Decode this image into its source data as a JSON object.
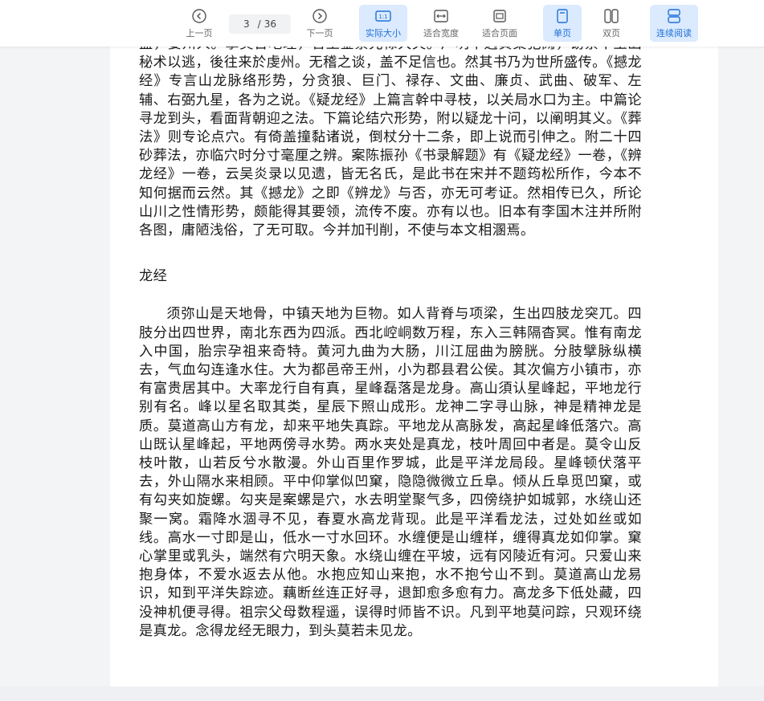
{
  "toolbar": {
    "prev_label": "上一页",
    "next_label": "下一页",
    "current_page": "3",
    "page_separator": "/",
    "total_pages": "36",
    "actual_size_label": "实际大小",
    "fit_width_label": "适合宽度",
    "fit_page_label": "适合页面",
    "single_page_label": "单页",
    "double_page_label": "双页",
    "continuous_label": "连续阅读",
    "active_color": "#1e6fd9",
    "active_bg": "#dbeafe"
  },
  "document": {
    "intro": "盖，娄州人。掌灵台地理，官至金紫光禄大夫。广明中遇黄巢犯阙，窃禁中玉函秘术以逃，後往来於虔州。无稽之谈，盖不足信也。然其书乃为世所盛传。《撼龙经》专言山龙脉络形势，分贪狼、巨门、禄存、文曲、廉贞、武曲、破军、左辅、右弼九星，各为之说。《疑龙经》上篇言幹中寻枝，以关局水口为主。中篇论寻龙到头，看面背朝迎之法。下篇论结穴形势，附以疑龙十问，以阐明其义。《葬法》则专论点穴。有倚盖撞黏诸说，倒杖分十二条，即上说而引伸之。附二十四砂葬法，亦临穴时分寸毫厘之辨。案陈振孙《书录解题》有《疑龙经》一卷，《辨龙经》一卷，云吴炎录以见遗，皆无名氏，是此书在宋并不题筠松所作，今本不知何据而云然。其《撼龙》之即《辨龙》与否，亦无可考证。然相传已久，所论山川之性情形势，颇能得其要领，流传不废。亦有以也。旧本有李国木注并所附各图，庸陋浅俗，了无可取。今并加刊削，不使与本文相溷焉。",
    "heading": "龙经",
    "body": "须弥山是天地骨，中镇天地为巨物。如人背脊与项梁，生出四肢龙突兀。四肢分出四世界，南北东西为四派。西北崆峒数万程，东入三韩隔杳冥。惟有南龙入中国，胎宗孕祖来奇特。黄河九曲为大肠，川江屈曲为膀胱。分肢擘脉纵横去，气血勾连逢水住。大为都邑帝王州，小为郡县君公侯。其次偏方小镇市，亦有富贵居其中。大率龙行自有真，星峰磊落是龙身。高山須认星峰起，平地龙行别有名。峰以星名取其类，星辰下照山成形。龙神二字寻山脉，神是精神龙是质。莫道高山方有龙，却来平地失真踪。平地龙从高脉发，高起星峰低落穴。高山既认星峰起，平地两傍寻水势。两水夹处是真龙，枝叶周回中者是。莫令山反枝叶散，山若反兮水散漫。外山百里作罗城，此是平洋龙局段。星峰顿伏落平去，外山隔水来相顾。平中仰掌似凹窠，隐隐微微立丘阜。倾从丘阜觅凹窠，或有勾夹如旋螺。勾夹是案螺是穴，水去明堂聚气多，四傍绕护如城郭，水绕山还聚一窝。霜降水涸寻不见，春夏水高龙背现。此是平洋看龙法，过处如丝或如线。高水一寸即是山，低水一寸水回环。水缠便是山缠样，缠得真龙如仰掌。窠心掌里或乳头，端然有穴明天象。水绕山缠在平坡，远有冈陵近有河。只爱山来抱身体，不爱水返去从他。水抱应知山来抱，水不抱兮山不到。莫道高山龙易识，知到平洋失踪迹。藕断丝连正好寻，退卸愈多愈有力。高龙多下低处藏，四没神机便寻得。祖宗父母数程遥，误得时师皆不识。凡到平地莫问踪，只观环绕是真龙。念得龙经无眼力，到头莫若未见龙。"
  }
}
